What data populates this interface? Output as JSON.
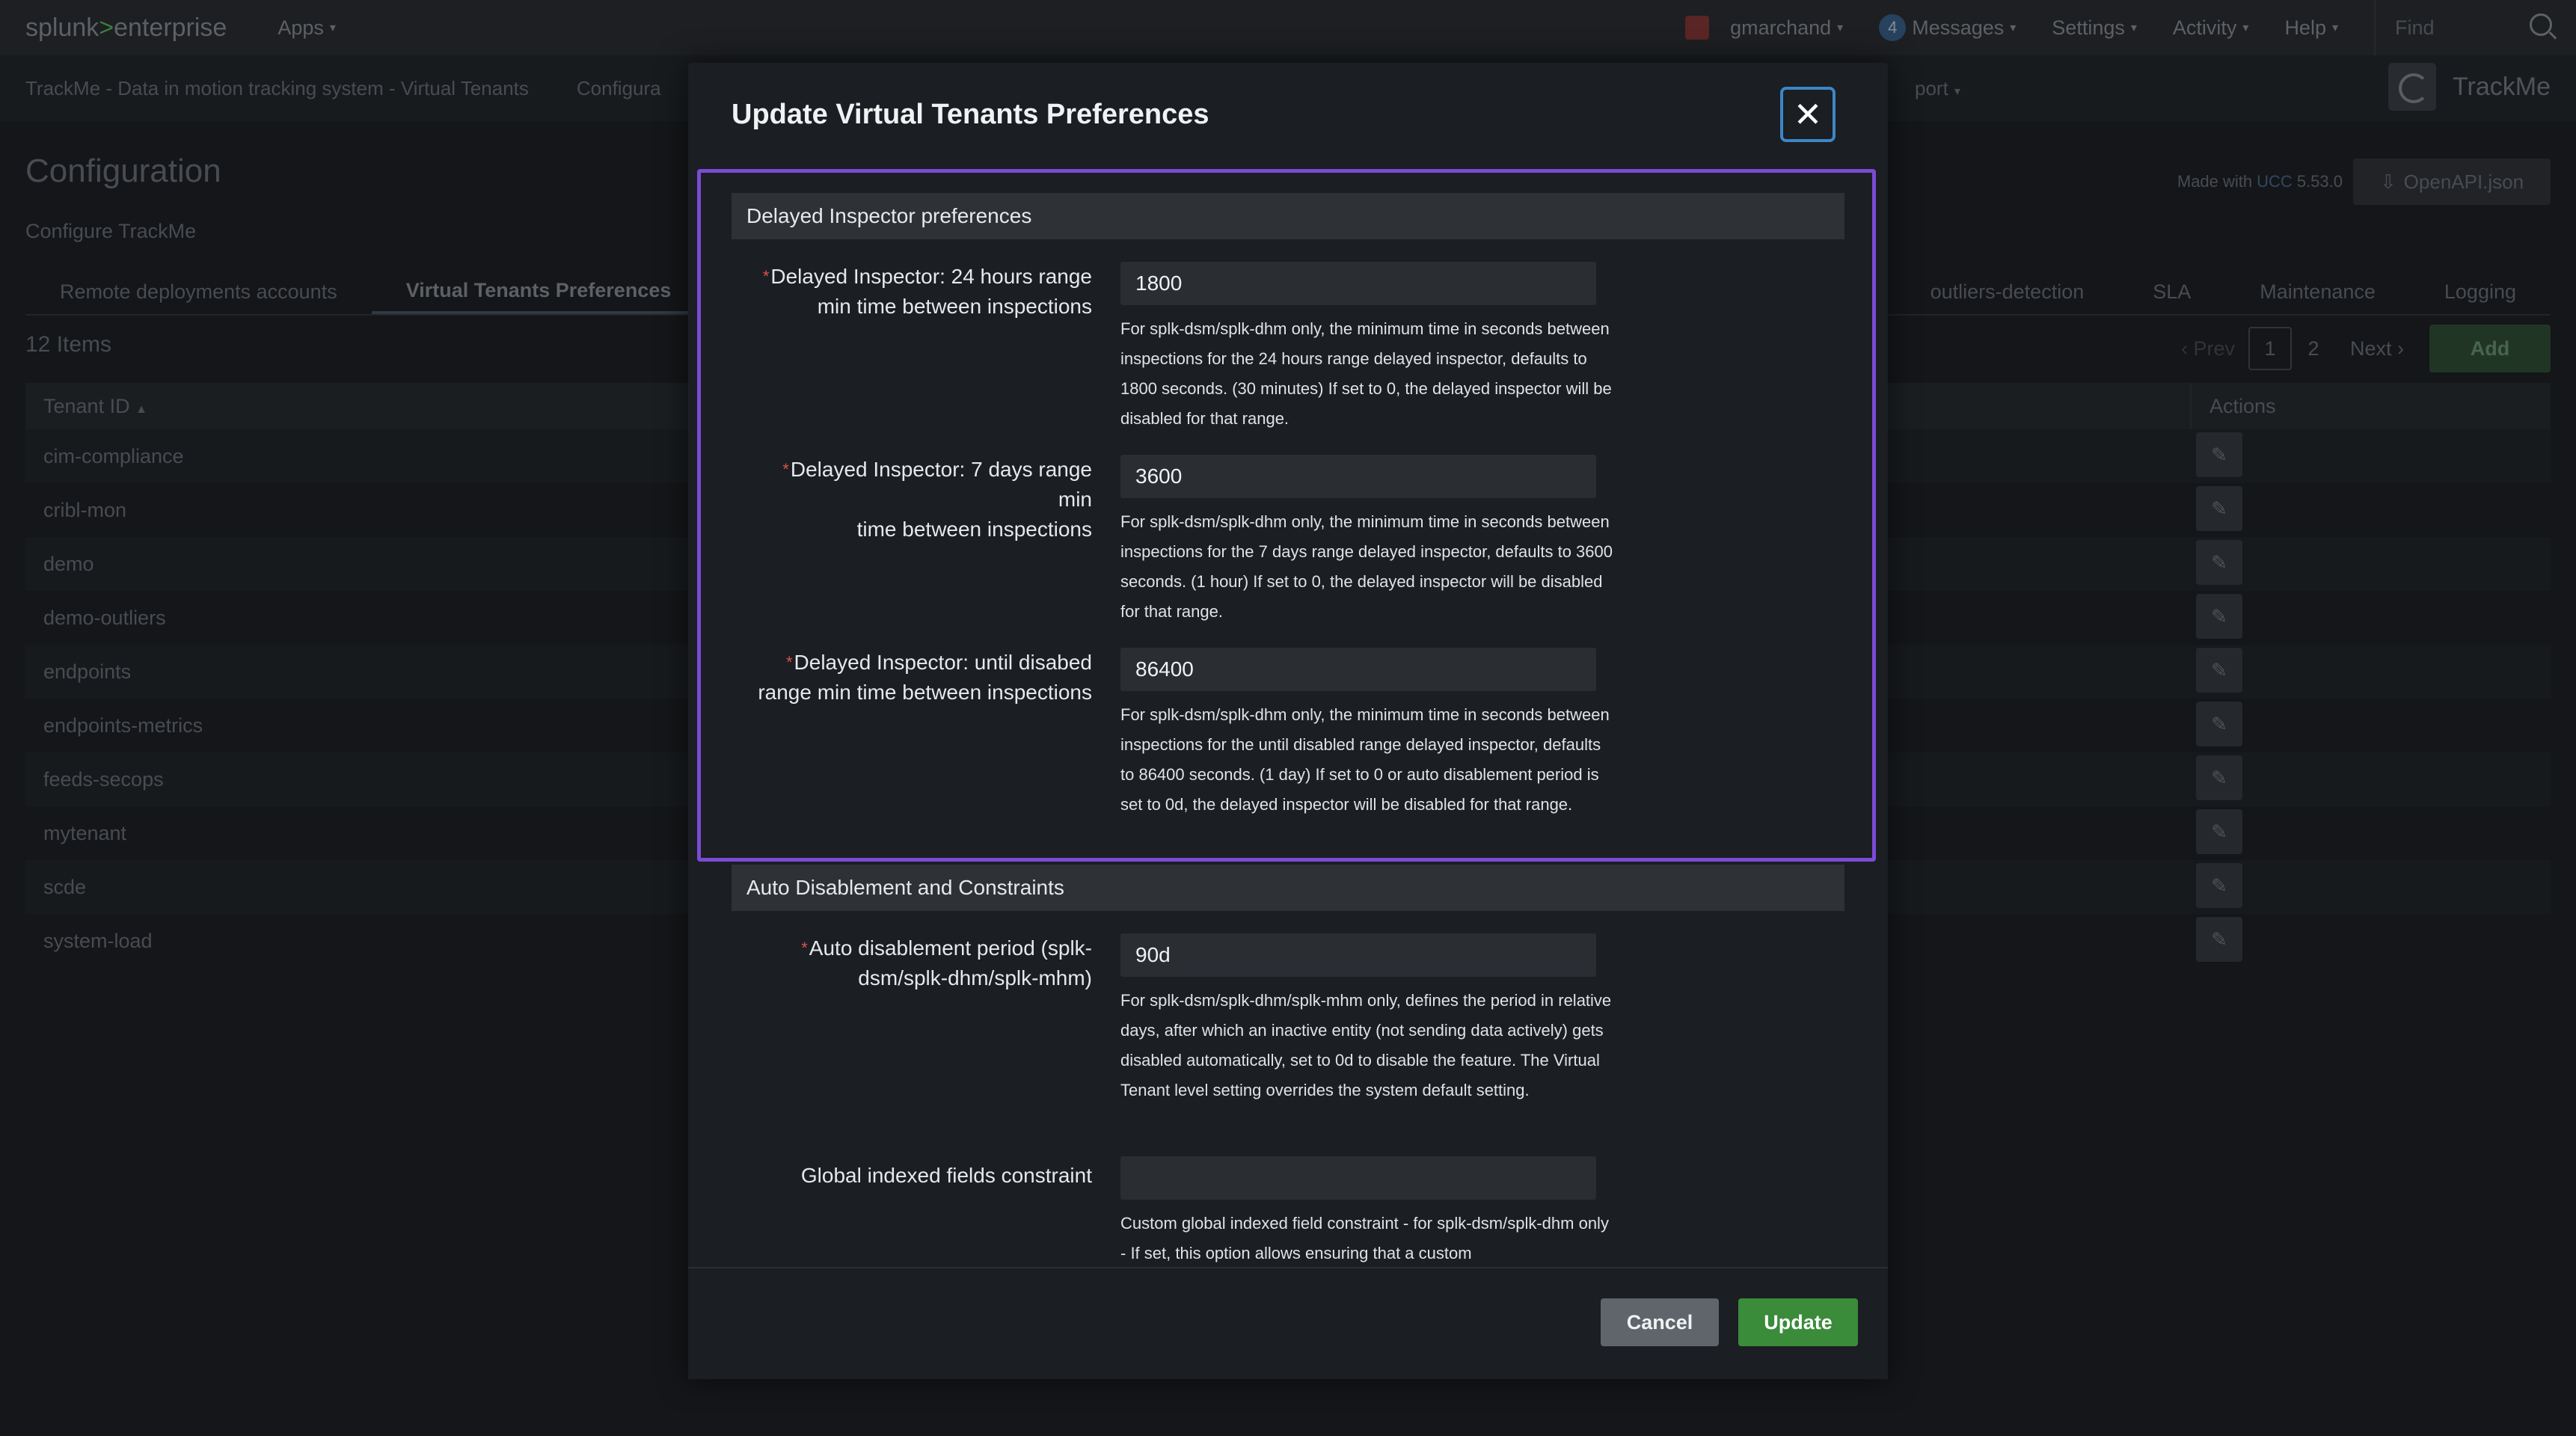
{
  "topbar": {
    "brand_splunk": "splunk",
    "brand_gt": ">",
    "brand_enterprise": "enterprise",
    "apps": "Apps",
    "user": "gmarchand",
    "messages_count": "4",
    "messages": "Messages",
    "settings": "Settings",
    "activity": "Activity",
    "help": "Help",
    "find_placeholder": "Find"
  },
  "appbar": {
    "nav": [
      "TrackMe - Data in motion tracking system - Virtual Tenants",
      "Configura"
    ],
    "nav_partial_right": "port",
    "logo_text": "TrackMe"
  },
  "page": {
    "title": "Configuration",
    "subtitle": "Configure TrackMe",
    "ucc_made_with": "Made with",
    "ucc_link": "UCC",
    "ucc_version": "5.53.0",
    "openapi_label": "OpenAPI.json",
    "tabs": [
      "Remote deployments accounts",
      "Virtual Tenants Preferences"
    ],
    "tabs_right": [
      "outliers-detection",
      "SLA",
      "Maintenance",
      "Logging"
    ],
    "items_count": "12 Items",
    "pager": {
      "prev": "Prev",
      "page1": "1",
      "page2": "2",
      "next": "Next"
    },
    "add_label": "Add"
  },
  "table": {
    "col_tenant": "Tenant ID",
    "col_actions": "Actions",
    "rows": [
      "cim-compliance",
      "cribl-mon",
      "demo",
      "demo-outliers",
      "endpoints",
      "endpoints-metrics",
      "feeds-secops",
      "mytenant",
      "scde",
      "system-load"
    ]
  },
  "modal": {
    "title": "Update Virtual Tenants Preferences",
    "section1": "Delayed Inspector preferences",
    "section2": "Auto Disablement and Constraints",
    "fields": [
      {
        "label1": "Delayed Inspector: 24 hours range",
        "label2": "min time between inspections",
        "value": "1800",
        "help": "For splk-dsm/splk-dhm only, the minimum time in seconds between inspections for the 24 hours range delayed inspector, defaults to 1800 seconds. (30 minutes) If set to 0, the delayed inspector will be disabled for that range."
      },
      {
        "label1": "Delayed Inspector: 7 days range min",
        "label2": "time between inspections",
        "value": "3600",
        "help": "For splk-dsm/splk-dhm only, the minimum time in seconds between inspections for the 7 days range delayed inspector, defaults to 3600 seconds. (1 hour) If set to 0, the delayed inspector will be disabled for that range."
      },
      {
        "label1": "Delayed Inspector: until disabed",
        "label2": "range min time between inspections",
        "value": "86400",
        "help": "For splk-dsm/splk-dhm only, the minimum time in seconds between inspections for the until disabled range delayed inspector, defaults to 86400 seconds. (1 day) If set to 0 or auto disablement period is set to 0d, the delayed inspector will be disabled for that range."
      },
      {
        "label1": "Auto disablement period (splk-",
        "label2": "dsm/splk-dhm/splk-mhm)",
        "value": "90d",
        "help": "For splk-dsm/splk-dhm/splk-mhm only, defines the period in relative days, after which an inactive entity (not sending data actively) gets disabled automatically, set to 0d to disable the feature. The Virtual Tenant level setting overrides the system default setting."
      },
      {
        "label1": "Global indexed fields constraint",
        "value": "",
        "help": "Custom global indexed field constraint - for splk-dsm/splk-dhm only - If set, this option allows ensuring that a custom"
      }
    ],
    "cancel": "Cancel",
    "update": "Update"
  },
  "colors": {
    "highlight": "#7c4ad8",
    "update_button": "#3a8b3a",
    "required": "#d9534f"
  }
}
